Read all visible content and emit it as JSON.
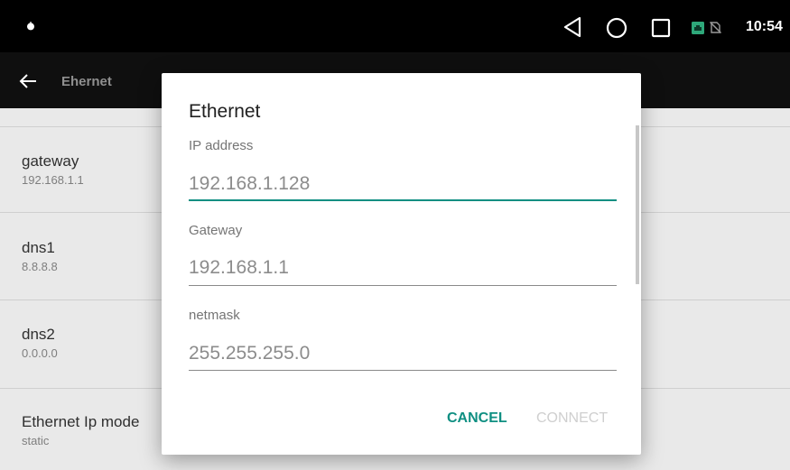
{
  "status_bar": {
    "time": "10:54",
    "icons": [
      "notification-dot-icon",
      "back-nav-icon",
      "home-nav-icon",
      "recents-nav-icon",
      "ethernet-status-icon",
      "no-sim-icon"
    ]
  },
  "app_bar": {
    "title": "Ehernet",
    "back_icon": "arrow-left-icon"
  },
  "settings_list": [
    {
      "title": "gateway",
      "value": "192.168.1.1"
    },
    {
      "title": "dns1",
      "value": "8.8.8.8"
    },
    {
      "title": "dns2",
      "value": "0.0.0.0"
    },
    {
      "title": "Ethernet Ip mode",
      "value": "static"
    }
  ],
  "dialog": {
    "title": "Ethernet",
    "fields": [
      {
        "label": "IP address",
        "placeholder": "192.168.1.128",
        "focused": true
      },
      {
        "label": "Gateway",
        "placeholder": "192.168.1.1",
        "focused": false
      },
      {
        "label": "netmask",
        "placeholder": "255.255.255.0",
        "focused": false
      }
    ],
    "cancel_label": "CANCEL",
    "connect_label": "CONNECT",
    "connect_enabled": false
  },
  "colors": {
    "accent": "#0f8f82",
    "status_bar": "#000000",
    "app_bar": "#0f0f0f",
    "list_background": "#e9e9e9",
    "dialog_background": "#ffffff",
    "disabled_text": "#cfcfcf",
    "ethernet_icon": "#2ea87a"
  }
}
